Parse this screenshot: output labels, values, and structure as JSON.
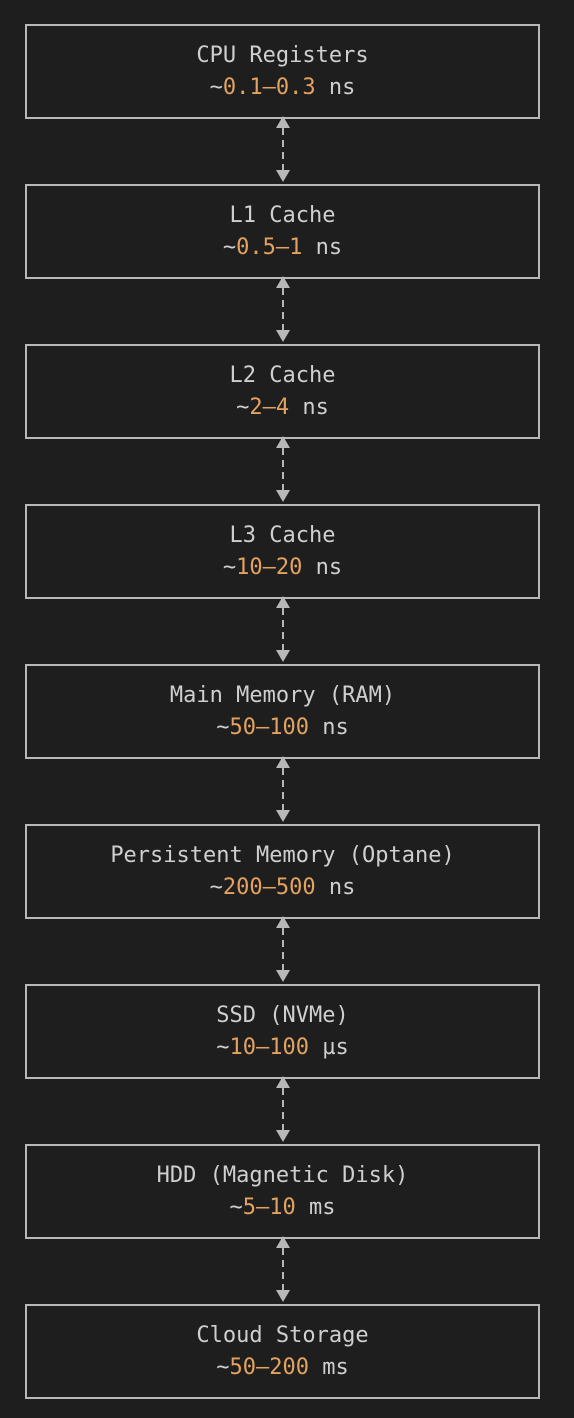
{
  "colors": {
    "background": "#1e1e1e",
    "text": "#cfcfcf",
    "number": "#e3a25f",
    "border": "#b8b8b8"
  },
  "levels": [
    {
      "name": "CPU Registers",
      "prefix": "~",
      "range": "0.1–0.3",
      "unit": "ns"
    },
    {
      "name": "L1 Cache",
      "prefix": "~",
      "range": "0.5–1",
      "unit": "ns"
    },
    {
      "name": "L2 Cache",
      "prefix": "~",
      "range": "2–4",
      "unit": "ns"
    },
    {
      "name": "L3 Cache",
      "prefix": "~",
      "range": "10–20",
      "unit": "ns"
    },
    {
      "name": "Main Memory (RAM)",
      "prefix": "~",
      "range": "50–100",
      "unit": "ns"
    },
    {
      "name": "Persistent Memory (Optane)",
      "prefix": "~",
      "range": "200–500",
      "unit": "ns"
    },
    {
      "name": "SSD (NVMe)",
      "prefix": "~",
      "range": "10–100",
      "unit": "µs"
    },
    {
      "name": "HDD (Magnetic Disk)",
      "prefix": "~",
      "range": "5–10",
      "unit": "ms"
    },
    {
      "name": "Cloud Storage",
      "prefix": "~",
      "range": "50–200",
      "unit": "ms"
    }
  ]
}
